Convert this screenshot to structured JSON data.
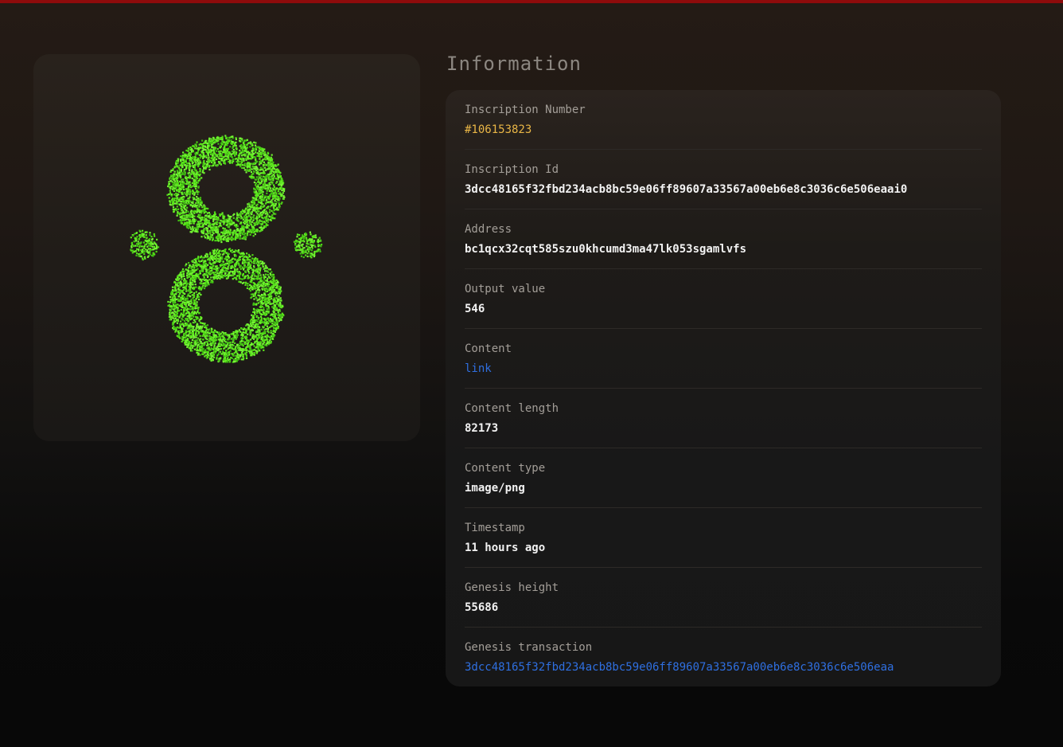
{
  "colors": {
    "background_top": "#241b15",
    "background_bottom": "#080808",
    "top_bar": "#8e0b0b",
    "inscription_number": "#e9b646",
    "link": "#2f6fe0",
    "artwork_green": "#5ce81c"
  },
  "preview": {
    "artwork": "green speckled figure-eight shape with two small dots"
  },
  "info": {
    "title": "Information",
    "inscription_number": {
      "label": "Inscription Number",
      "value": "#106153823"
    },
    "inscription_id": {
      "label": "Inscription Id",
      "value": "3dcc48165f32fbd234acb8bc59e06ff89607a33567a00eb6e8c3036c6e506eaai0"
    },
    "address": {
      "label": "Address",
      "value": "bc1qcx32cqt585szu0khcumd3ma47lk053sgamlvfs"
    },
    "output_value": {
      "label": "Output value",
      "value": "546"
    },
    "content": {
      "label": "Content",
      "value": "link"
    },
    "content_length": {
      "label": "Content length",
      "value": "82173"
    },
    "content_type": {
      "label": "Content type",
      "value": "image/png"
    },
    "timestamp": {
      "label": "Timestamp",
      "value": "11 hours ago"
    },
    "genesis_height": {
      "label": "Genesis height",
      "value": "55686"
    },
    "genesis_transaction": {
      "label": "Genesis transaction",
      "value": "3dcc48165f32fbd234acb8bc59e06ff89607a33567a00eb6e8c3036c6e506eaa"
    }
  }
}
